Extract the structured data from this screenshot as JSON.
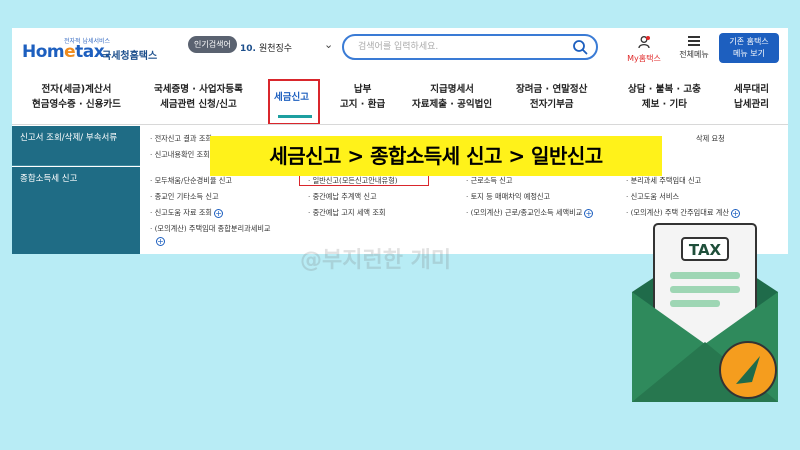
{
  "header": {
    "logo_small": "전자적 납세서비스",
    "logo_home": "Hom",
    "logo_e": "e",
    "logo_tax": "tax.",
    "logo_kr": "국세청홈택스",
    "popular_badge": "인기검색어",
    "popular_rank": "10.",
    "popular_term": "원천징수",
    "search_placeholder": "검색어를 입력하세요.",
    "my_home": "My홈택스",
    "all_menu": "전체메뉴",
    "classic_line1": "기존 홈택스",
    "classic_line2": "메뉴 보기"
  },
  "gnb": [
    {
      "line1": "전자(세금)계산서",
      "line2": "현금영수증 · 신용카드"
    },
    {
      "line1": "국세증명 · 사업자등록",
      "line2": "세금관련 신청/신고"
    },
    {
      "line1": "세금신고",
      "line2": ""
    },
    {
      "line1": "납부",
      "line2": "고지 · 환급"
    },
    {
      "line1": "지급명세서",
      "line2": "자료제출 · 공익법인"
    },
    {
      "line1": "장려금 · 연말정산",
      "line2": "전자기부금"
    },
    {
      "line1": "상담 · 불복 · 고충",
      "line2": "제보 · 기타"
    },
    {
      "line1": "세무대리",
      "line2": "납세관리"
    }
  ],
  "submenu": {
    "cat1": "신고서 조회/삭제/ 부속서류",
    "cat1_links": [
      "· 전자신고 결과 조회",
      "· 신고내용확인 조회",
      "삭제 요청"
    ],
    "cat2": "종합소득세 신고",
    "col1": [
      "· 모두채움/단순경비율 신고",
      "· 종교인 기타소득 신고",
      "· 신고도움 자료 조회",
      "· (모의계산) 주택임대 종합분리과세비교"
    ],
    "col2": [
      "· 일반신고(모든신고안내유형)",
      "· 중간예납 추계액 신고",
      "· 중간예납 고지 세액 조회"
    ],
    "col3": [
      "· 근로소득 신고",
      "· 토지 등 매매차익 예정신고",
      "· (모의계산) 근로/종교인소득 세액비교"
    ],
    "col4": [
      "· 분리과세 주택임대 신고",
      "· 신고도움 서비스",
      "· (모의계산) 주택 간주임대료 계산"
    ]
  },
  "banner": "세금신고 > 종합소득세 신고 > 일반신고",
  "watermark": "@부지런한 개미",
  "illustration": {
    "tax_label": "TAX"
  },
  "colors": {
    "accent_blue": "#1d5fbf",
    "teal": "#1f6c85",
    "highlight_red": "#d9262c",
    "banner_yellow": "#fff21a",
    "background": "#b8ecf5"
  }
}
